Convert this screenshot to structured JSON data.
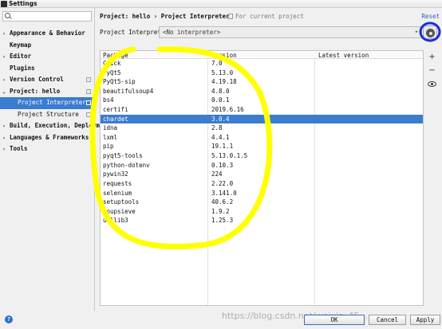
{
  "window": {
    "title": "Settings"
  },
  "sidebar": {
    "search_placeholder": "",
    "items": [
      {
        "label": "Appearance & Behavior",
        "arrow": "›",
        "level": 0
      },
      {
        "label": "Keymap",
        "arrow": "",
        "level": 0
      },
      {
        "label": "Editor",
        "arrow": "›",
        "level": 0
      },
      {
        "label": "Plugins",
        "arrow": "",
        "level": 0
      },
      {
        "label": "Version Control",
        "arrow": "›",
        "level": 0
      },
      {
        "label": "Project: hello",
        "arrow": "⌄",
        "level": 0
      },
      {
        "label": "Project Interpreter",
        "arrow": "",
        "level": 1
      },
      {
        "label": "Project Structure",
        "arrow": "",
        "level": 1
      },
      {
        "label": "Build, Execution, Deployment",
        "arrow": "›",
        "level": 0
      },
      {
        "label": "Languages & Frameworks",
        "arrow": "›",
        "level": 0
      },
      {
        "label": "Tools",
        "arrow": "›",
        "level": 0
      }
    ]
  },
  "header": {
    "breadcrumb": "Project: hello › Project Interpreter",
    "for_current": "For current project",
    "reset": "Reset"
  },
  "interpreter": {
    "label": "Project Interpreter:",
    "value": "<No interpreter>"
  },
  "table": {
    "columns": [
      "Package",
      "Version",
      "Latest version"
    ],
    "rows": [
      {
        "package": "Click",
        "version": "7.0",
        "latest": ""
      },
      {
        "package": "PyQt5",
        "version": "5.13.0",
        "latest": ""
      },
      {
        "package": "PyQt5-sip",
        "version": "4.19.18",
        "latest": ""
      },
      {
        "package": "beautifulsoup4",
        "version": "4.8.0",
        "latest": ""
      },
      {
        "package": "bs4",
        "version": "0.0.1",
        "latest": ""
      },
      {
        "package": "certifi",
        "version": "2019.6.16",
        "latest": ""
      },
      {
        "package": "chardet",
        "version": "3.0.4",
        "latest": ""
      },
      {
        "package": "idna",
        "version": "2.8",
        "latest": ""
      },
      {
        "package": "lxml",
        "version": "4.4.1",
        "latest": ""
      },
      {
        "package": "pip",
        "version": "19.1.1",
        "latest": ""
      },
      {
        "package": "pyqt5-tools",
        "version": "5.13.0.1.5",
        "latest": ""
      },
      {
        "package": "python-dotenv",
        "version": "0.10.3",
        "latest": ""
      },
      {
        "package": "pywin32",
        "version": "224",
        "latest": ""
      },
      {
        "package": "requests",
        "version": "2.22.0",
        "latest": ""
      },
      {
        "package": "selenium",
        "version": "3.141.0",
        "latest": ""
      },
      {
        "package": "setuptools",
        "version": "40.6.2",
        "latest": ""
      },
      {
        "package": "soupsieve",
        "version": "1.9.2",
        "latest": ""
      },
      {
        "package": "urllib3",
        "version": "1.25.3",
        "latest": ""
      }
    ],
    "selected_index": 6
  },
  "tools": {
    "add": "+",
    "remove": "−"
  },
  "footer": {
    "ok": "OK",
    "cancel": "Cancel",
    "apply": "Apply"
  },
  "watermark": "https://blog.csdn.net/weixin_45...",
  "colors": {
    "selection": "#3b7bd0",
    "annotation_yellow": "#ffff00",
    "annotation_blue": "#1a2fe0",
    "link": "#2a5fb0"
  },
  "icons": [
    "app-icon",
    "search-icon",
    "copy-icon",
    "gear-icon",
    "add-icon",
    "remove-icon",
    "eye-icon",
    "help-icon",
    "folder-doc-icon"
  ]
}
